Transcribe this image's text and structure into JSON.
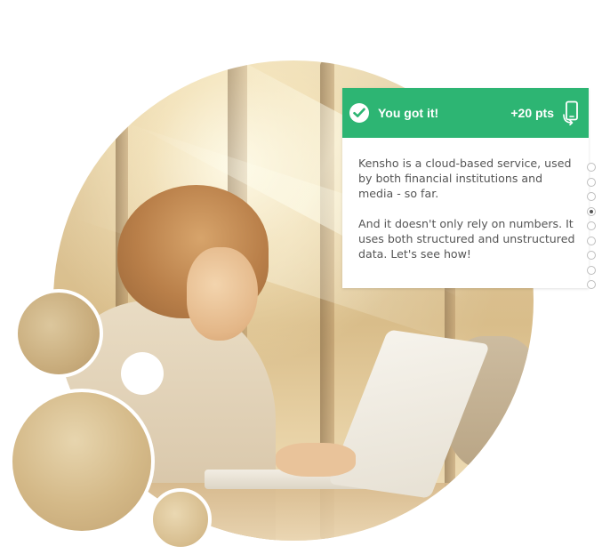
{
  "notification": {
    "title": "You got it!",
    "points": "+20 pts",
    "status_icon": "check-circle-icon",
    "device_icon": "phone-rotate-icon",
    "header_color": "#2db573",
    "paragraphs": [
      "Kensho is a cloud-based service, used by both financial institutions and media - so far.",
      "And it doesn't only rely on numbers. It uses both structured and unstructured data. Let's see how!"
    ]
  },
  "progress": {
    "total_steps": 9,
    "active_step": 4
  }
}
